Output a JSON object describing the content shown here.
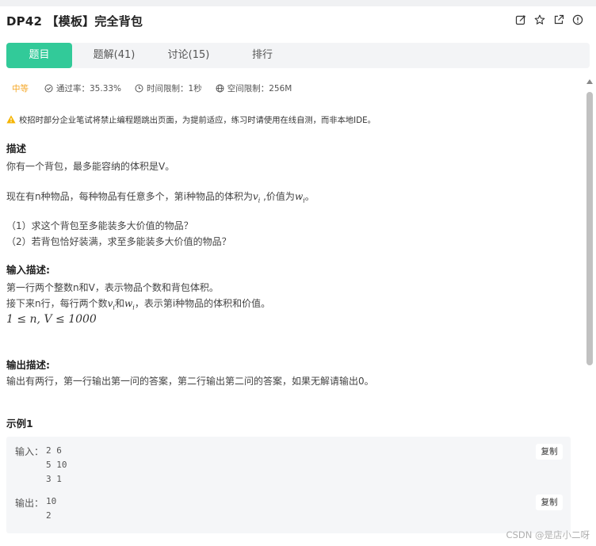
{
  "problem": {
    "title": "DP42 【模板】完全背包"
  },
  "header_icons": [
    "edit-icon",
    "star-icon",
    "external-link-icon",
    "info-icon"
  ],
  "tabs": [
    {
      "label": "题目",
      "active": true
    },
    {
      "label": "题解(41)",
      "active": false
    },
    {
      "label": "讨论(15)",
      "active": false
    },
    {
      "label": "排行",
      "active": false
    }
  ],
  "meta": {
    "difficulty": "中等",
    "pass_rate": "通过率：35.33%",
    "time_limit": "时间限制：1秒",
    "space_limit": "空间限制：256M"
  },
  "notice": "校招时部分企业笔试将禁止编程题跳出页面，为提前适应，练习时请使用在线自测，而非本地IDE。",
  "description": {
    "heading": "描述",
    "line1": "你有一个背包，最多能容纳的体积是V。",
    "line2_a": "现在有n种物品，每种物品有任意多个，第i种物品的体积为",
    "line2_v": "v",
    "line2_i1": "i",
    "line2_b": " ,价值为",
    "line2_w": "w",
    "line2_i2": "i",
    "line2_c": "。",
    "q1": "（1）求这个背包至多能装多大价值的物品？",
    "q2": "（2）若背包恰好装满，求至多能装多大价值的物品？"
  },
  "input_desc": {
    "heading": "输入描述:",
    "line1": "第一行两个整数n和V，表示物品个数和背包体积。",
    "line2_a": "接下来n行，每行两个数",
    "line2_v": "v",
    "line2_i1": "i",
    "line2_b": "和",
    "line2_w": "w",
    "line2_i2": "i",
    "line2_c": "，表示第i种物品的体积和价值。",
    "constraint": "1 ≤ n, V ≤ 1000"
  },
  "output_desc": {
    "heading": "输出描述:",
    "line1": "输出有两行，第一行输出第一问的答案，第二行输出第二问的答案，如果无解请输出0。"
  },
  "example": {
    "heading": "示例1",
    "input_label": "输入：",
    "input_code": "2 6\n5 10\n3 1",
    "output_label": "输出：",
    "output_code": "10\n2",
    "copy_label": "复制"
  },
  "watermark": "CSDN @是店小二呀",
  "colors": {
    "accent": "#32ca99",
    "difficulty": "#f5a623",
    "warning": "#f5b400"
  }
}
